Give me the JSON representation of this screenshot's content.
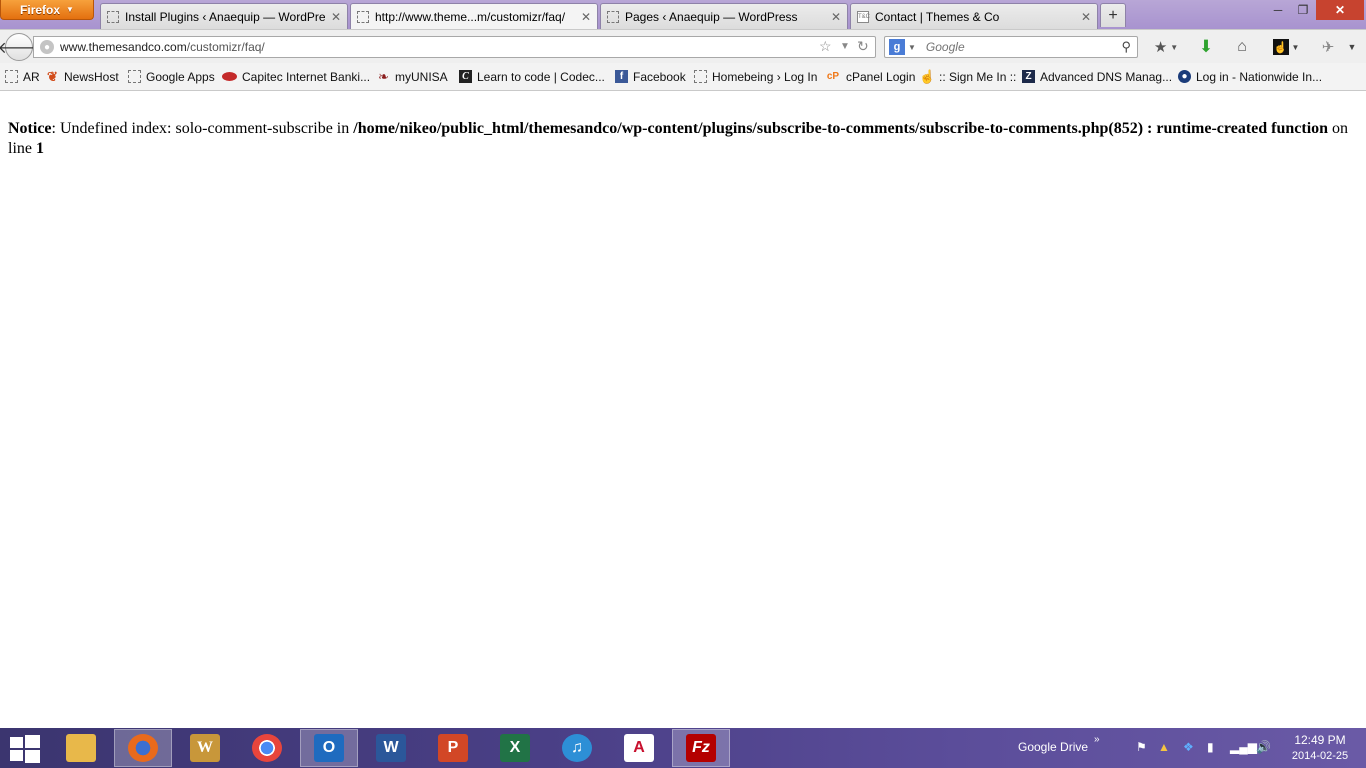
{
  "browser": {
    "menu_button": "Firefox",
    "tabs": [
      {
        "label": "Install Plugins ‹ Anaequip — WordPre...",
        "active": false
      },
      {
        "label": "http://www.theme...m/customizr/faq/",
        "active": true
      },
      {
        "label": "Pages ‹ Anaequip — WordPress",
        "active": false
      },
      {
        "label": "Contact | Themes & Co",
        "active": false,
        "favicon": "T&C"
      }
    ],
    "new_tab": "+",
    "window_controls": {
      "minimize": "─",
      "maximize": "❐",
      "close": "✕"
    }
  },
  "navbar": {
    "url_host": "www.themesandco.com",
    "url_path": "/customizr/faq/",
    "search_engine_icon": "g",
    "search_placeholder": "Google"
  },
  "bookmarks": [
    {
      "label": "AR",
      "icon": "page-icon"
    },
    {
      "label": "NewsHost",
      "icon": "newshost-icon"
    },
    {
      "label": "Google Apps",
      "icon": "page-icon"
    },
    {
      "label": "Capitec Internet Banki...",
      "icon": "capitec-icon"
    },
    {
      "label": "myUNISA",
      "icon": "unisa-icon"
    },
    {
      "label": "Learn to code | Codec...",
      "icon": "codecademy-icon"
    },
    {
      "label": "Facebook",
      "icon": "facebook-icon"
    },
    {
      "label": "Homebeing › Log In",
      "icon": "page-icon"
    },
    {
      "label": "cPanel Login",
      "icon": "cpanel-icon"
    },
    {
      "label": ":: Sign Me In ::",
      "icon": "thumb-icon"
    },
    {
      "label": "Advanced DNS Manag...",
      "icon": "zone-icon"
    },
    {
      "label": "Log in - Nationwide In...",
      "icon": "nationwide-icon"
    }
  ],
  "page": {
    "notice_label": "Notice",
    "notice_text1": ": Undefined index: solo-comment-subscribe in ",
    "notice_path": "/home/nikeo/public_html/themesandco/wp-content/plugins/subscribe-to-comments/subscribe-to-comments.php(852) : runtime-created function",
    "notice_text2": " on line ",
    "notice_line": "1"
  },
  "taskbar": {
    "apps": [
      {
        "name": "file-explorer",
        "glyph": "",
        "color": "#e8b84a",
        "active": false
      },
      {
        "name": "firefox",
        "glyph": "",
        "color": "#e96a1c",
        "active": true
      },
      {
        "name": "wordweb",
        "glyph": "W",
        "color": "#c8973a",
        "active": false
      },
      {
        "name": "chrome",
        "glyph": "",
        "color": "#3aa757",
        "active": false
      },
      {
        "name": "outlook",
        "glyph": "O",
        "color": "#1f6bbf",
        "active": true
      },
      {
        "name": "word",
        "glyph": "W",
        "color": "#2b579a",
        "active": false
      },
      {
        "name": "powerpoint",
        "glyph": "P",
        "color": "#d24726",
        "active": false
      },
      {
        "name": "excel",
        "glyph": "X",
        "color": "#217346",
        "active": false
      },
      {
        "name": "itunes",
        "glyph": "♫",
        "color": "#2d8fd6",
        "active": false
      },
      {
        "name": "acrobat",
        "glyph": "A",
        "color": "#c8102e",
        "active": false
      },
      {
        "name": "filezilla",
        "glyph": "Fz",
        "color": "#b40000",
        "active": true
      }
    ],
    "tray_label": "Google Drive",
    "clock_time": "12:49 PM",
    "clock_date": "2014-02-25"
  }
}
